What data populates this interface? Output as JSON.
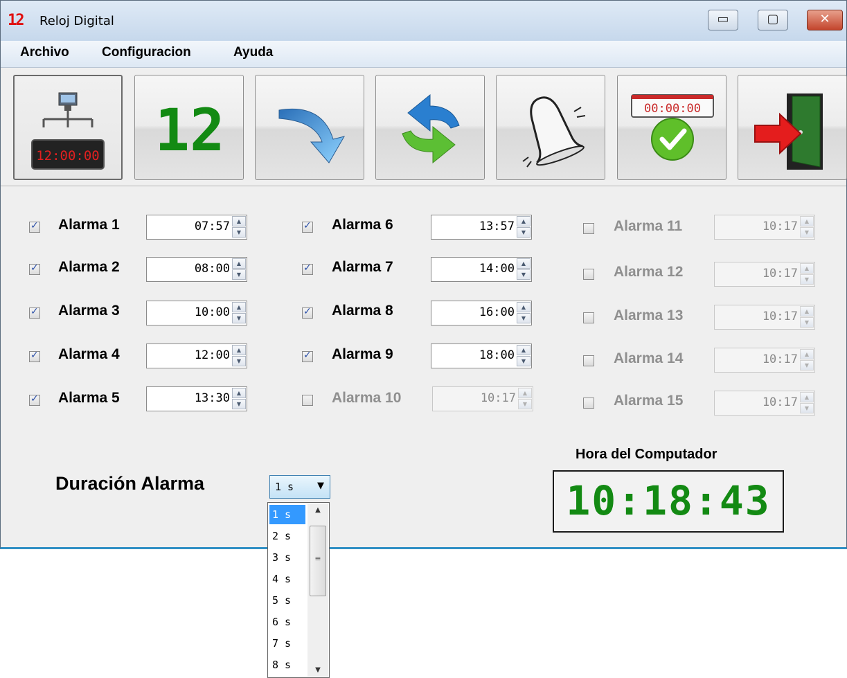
{
  "window": {
    "title": "Reloj Digital",
    "icon_text": "12"
  },
  "window_controls": {
    "minimize": "▭",
    "maximize": "▢",
    "close": "✕"
  },
  "menu": [
    "Archivo",
    "Configuracion",
    "Ayuda"
  ],
  "toolbar": {
    "buttons": [
      {
        "name": "network-clock-icon",
        "clock_text": "12:00:00"
      },
      {
        "name": "digital-12-icon",
        "text": "12"
      },
      {
        "name": "arrow-down-icon"
      },
      {
        "name": "refresh-icon"
      },
      {
        "name": "bell-icon"
      },
      {
        "name": "timer-check-icon",
        "timer_text": "00:00:00"
      },
      {
        "name": "exit-door-icon"
      }
    ]
  },
  "alarms": [
    {
      "label": "Alarma 1",
      "time": "07:57",
      "checked": true
    },
    {
      "label": "Alarma 2",
      "time": "08:00",
      "checked": true
    },
    {
      "label": "Alarma 3",
      "time": "10:00",
      "checked": true
    },
    {
      "label": "Alarma 4",
      "time": "12:00",
      "checked": true
    },
    {
      "label": "Alarma 5",
      "time": "13:30",
      "checked": true
    },
    {
      "label": "Alarma 6",
      "time": "13:57",
      "checked": true
    },
    {
      "label": "Alarma 7",
      "time": "14:00",
      "checked": true
    },
    {
      "label": "Alarma 8",
      "time": "16:00",
      "checked": true
    },
    {
      "label": "Alarma 9",
      "time": "18:00",
      "checked": true
    },
    {
      "label": "Alarma 10",
      "time": "10:17",
      "checked": false
    },
    {
      "label": "Alarma 11",
      "time": "10:17",
      "checked": false
    },
    {
      "label": "Alarma 12",
      "time": "10:17",
      "checked": false
    },
    {
      "label": "Alarma 13",
      "time": "10:17",
      "checked": false
    },
    {
      "label": "Alarma 14",
      "time": "10:17",
      "checked": false
    },
    {
      "label": "Alarma 15",
      "time": "10:17",
      "checked": false
    }
  ],
  "duration": {
    "label": "Duración Alarma",
    "selected": "1 s",
    "options": [
      "1 s",
      "2 s",
      "3 s",
      "4 s",
      "5 s",
      "6 s",
      "7 s",
      "8 s"
    ]
  },
  "computer_time": {
    "label": "Hora del Computador",
    "value": "10:18:43"
  },
  "colors": {
    "digit_green": "#138a13",
    "selection_blue": "#3399ff",
    "accent_border": "#2f8fc4"
  }
}
